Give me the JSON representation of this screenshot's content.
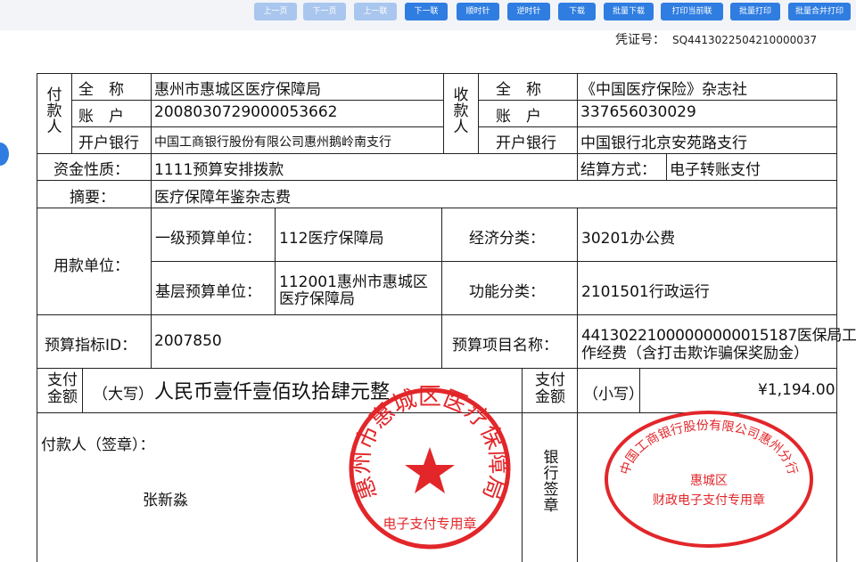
{
  "toolbar": {
    "buttons": [
      "上一页",
      "下一页",
      "上一联",
      "下一联",
      "顺时针",
      "逆时针",
      "下载",
      "批量下载",
      "打印当前联",
      "批量打印",
      "批量合并打印"
    ]
  },
  "voucher": {
    "label": "凭证号：",
    "number": "SQ4413022504210000037"
  },
  "payer": {
    "side_label": "付款人",
    "name_label": "全　称",
    "name": "惠州市惠城区医疗保障局",
    "account_label": "账　户",
    "account": "2008030729000053662",
    "bank_label": "开户银行",
    "bank": "中国工商银行股份有限公司惠州鹅岭南支行"
  },
  "payee": {
    "side_label": "收款人",
    "name_label": "全　称",
    "name": "《中国医疗保险》杂志社",
    "account_label": "账　户",
    "account": "337656030029",
    "bank_label": "开户银行",
    "bank": "中国银行北京安苑路支行"
  },
  "fund_nature_label": "资金性质：",
  "fund_nature": "1111预算安排拨款",
  "settlement_label": "结算方式：",
  "settlement": "电子转账支付",
  "summary_label": "摘要：",
  "summary": "医疗保障年鉴杂志费",
  "user_unit_label": "用款单位：",
  "first_budget_label": "一级预算单位：",
  "first_budget": "112医疗保障局",
  "base_budget_label": "基层预算单位：",
  "base_budget_line1": "112001惠州市惠城区",
  "base_budget_line2": "医疗保障局",
  "econ_label": "经济分类：",
  "econ": "30201办公费",
  "func_label": "功能分类：",
  "func": "2101501行政运行",
  "indicator_label": "预算指标ID：",
  "indicator": "2007850",
  "project_label": "预算项目名称：",
  "project_line1": "44130221000000000015187医保局工",
  "project_line2": "作经费（含打击欺诈骗保奖励金）",
  "amount_label": "支付金额",
  "upper_label": "（大写）",
  "upper": "人民币壹仟壹佰玖拾肆元整",
  "lower_label": "（小写）",
  "lower": "¥1,194.00",
  "payer_sign_label": "付款人（签章）：",
  "payer_signer": "张新淼",
  "bank_sign_label": "银行签章",
  "stamp_payer": {
    "text_arc": "惠州市惠城区医疗保障局",
    "text_bottom": "电子支付专用章",
    "color": "#e2262a"
  },
  "stamp_bank": {
    "text_arc": "中国工商银行股份有限公司惠州分行",
    "text_line1": "惠城区",
    "text_line2": "财政电子支付专用章",
    "color": "#e2262a"
  },
  "colors": {
    "accent": "#2f7de1",
    "accent_disabled": "#a9c6ee"
  }
}
